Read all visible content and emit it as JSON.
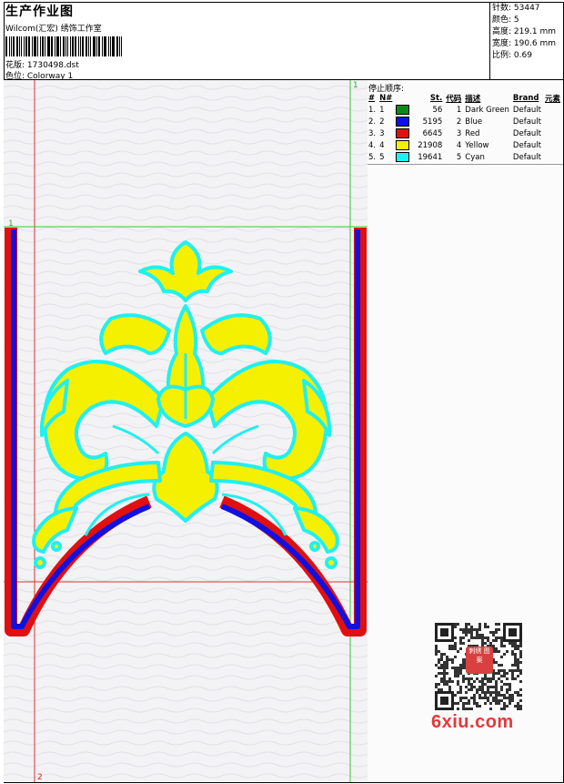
{
  "header": {
    "title": "生产作业图",
    "subtitle": "Wilcom(汇宏) 绣饰工作室",
    "pattern_label": "花版: 1730498.dst",
    "colorway_label": "色位: Colorway 1"
  },
  "stats": {
    "stitches": "针数: 53447",
    "colors": "颜色: 5",
    "height": "高度: 219.1 mm",
    "width": "宽度: 190.6 mm",
    "scale": "比例: 0.69"
  },
  "canvas_marks": {
    "top_left_marker": "1",
    "top_right_marker": "1",
    "bottom_marker": "2"
  },
  "stop_sequence": {
    "title": "停止顺序:",
    "columns": [
      "#",
      "N#",
      "St.",
      "代码",
      "描述",
      "Brand",
      "元素"
    ],
    "rows": [
      {
        "idx": "1.",
        "n": "1",
        "st": "56",
        "code": "1",
        "desc": "Dark Green",
        "brand": "Default",
        "color": "#0a8a1a"
      },
      {
        "idx": "2.",
        "n": "2",
        "st": "5195",
        "code": "2",
        "desc": "Blue",
        "brand": "Default",
        "color": "#1010e0"
      },
      {
        "idx": "3.",
        "n": "3",
        "st": "6645",
        "code": "3",
        "desc": "Red",
        "brand": "Default",
        "color": "#e01010"
      },
      {
        "idx": "4.",
        "n": "4",
        "st": "21908",
        "code": "4",
        "desc": "Yellow",
        "brand": "Default",
        "color": "#f5f000"
      },
      {
        "idx": "5.",
        "n": "5",
        "st": "19641",
        "code": "5",
        "desc": "Cyan",
        "brand": "Default",
        "color": "#20f0f0"
      }
    ]
  },
  "watermark": {
    "logo": "6xiu.com",
    "stamp": "刺绣 图案"
  },
  "colors": {
    "red": "#e01010",
    "blue": "#1010e0",
    "yellow": "#f5f000",
    "cyan": "#20f0f0",
    "guide_green": "#33cc33"
  }
}
